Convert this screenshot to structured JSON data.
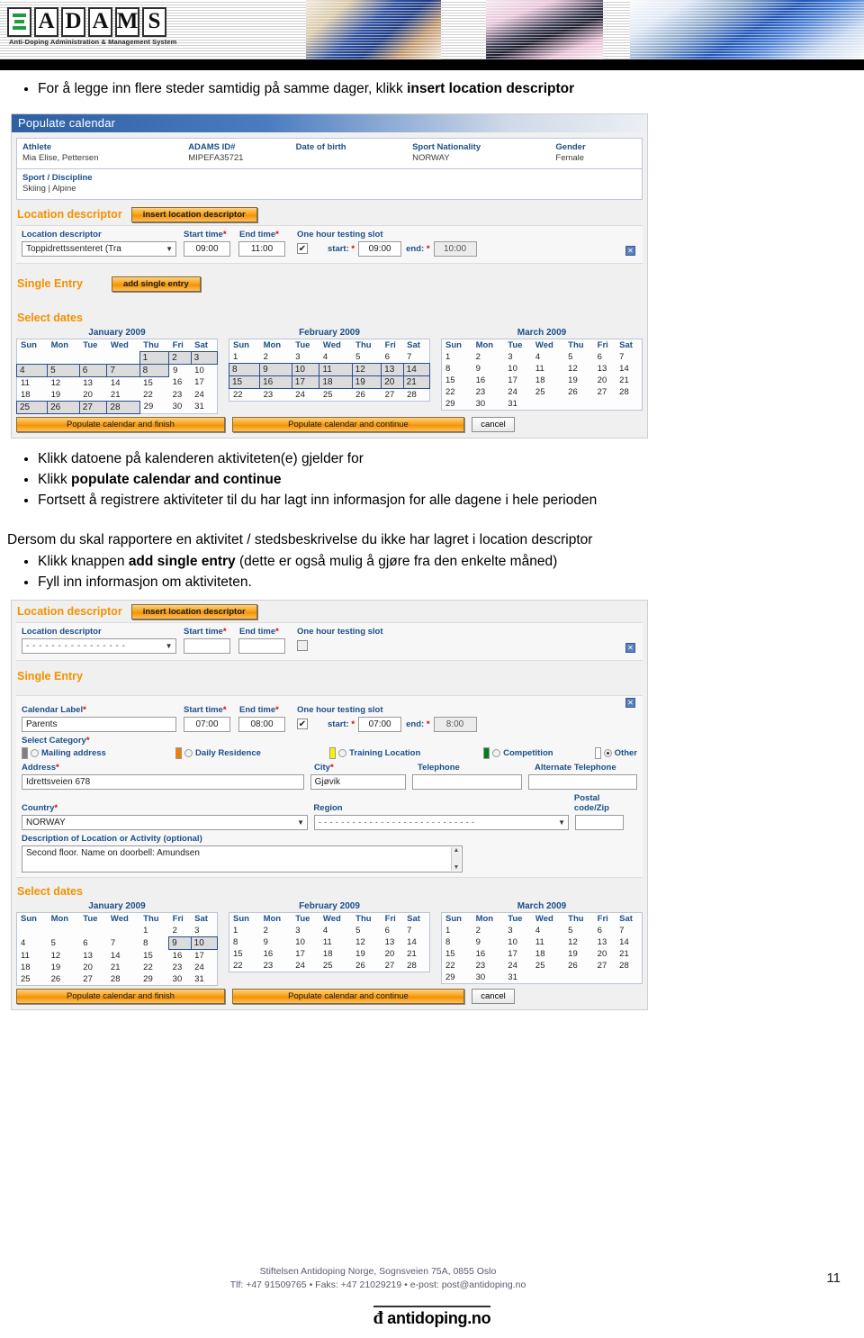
{
  "banner": {
    "logo_letters": [
      "A",
      "D",
      "A",
      "M",
      "S"
    ],
    "subtitle": "Anti-Doping Administration & Management System"
  },
  "intro_bullets": [
    {
      "text": "For å legge inn flere steder samtidig på samme dager, klikk ",
      "bold": "insert location descriptor"
    }
  ],
  "screenshot1": {
    "title": "Populate calendar",
    "athlete": {
      "labels": [
        "Athlete",
        "ADAMS ID#",
        "Date of birth",
        "Sport Nationality",
        "Gender"
      ],
      "values": [
        "Mia Elise, Pettersen",
        "MIPEFA35721",
        "",
        "NORWAY",
        "Female"
      ],
      "sport_label": "Sport / Discipline",
      "sport_value": "Skiing | Alpine"
    },
    "location_section": {
      "title": "Location descriptor",
      "button": "insert location descriptor",
      "headers": [
        "Location descriptor",
        "Start time",
        "End time",
        "One hour testing slot"
      ],
      "descriptor_value": "Toppidrettssenteret (Tra",
      "start_time": "09:00",
      "end_time": "11:00",
      "checkbox_checked": true,
      "slot_start_label": "start:",
      "slot_start": "09:00",
      "slot_end_label": "end:",
      "slot_end": "10:00"
    },
    "single_entry": {
      "title": "Single Entry",
      "button": "add single entry"
    },
    "select_dates": {
      "title": "Select dates",
      "weekdays": [
        "Sun",
        "Mon",
        "Tue",
        "Wed",
        "Thu",
        "Fri",
        "Sat"
      ],
      "months": [
        {
          "name": "January 2009",
          "weeks": [
            [
              "",
              "",
              "",
              "",
              "1",
              "2",
              "3"
            ],
            [
              "4",
              "5",
              "6",
              "7",
              "8",
              "9",
              "10"
            ],
            [
              "11",
              "12",
              "13",
              "14",
              "15",
              "16",
              "17"
            ],
            [
              "18",
              "19",
              "20",
              "21",
              "22",
              "23",
              "24"
            ],
            [
              "25",
              "26",
              "27",
              "28",
              "29",
              "30",
              "31"
            ]
          ],
          "selected": [
            "1",
            "2",
            "3",
            "4",
            "5",
            "6",
            "7",
            "8",
            "25",
            "26",
            "27",
            "28"
          ]
        },
        {
          "name": "February 2009",
          "weeks": [
            [
              "1",
              "2",
              "3",
              "4",
              "5",
              "6",
              "7"
            ],
            [
              "8",
              "9",
              "10",
              "11",
              "12",
              "13",
              "14"
            ],
            [
              "15",
              "16",
              "17",
              "18",
              "19",
              "20",
              "21"
            ],
            [
              "22",
              "23",
              "24",
              "25",
              "26",
              "27",
              "28"
            ]
          ],
          "selected": [
            "8",
            "9",
            "10",
            "11",
            "12",
            "13",
            "14",
            "15",
            "16",
            "17",
            "18",
            "19",
            "20",
            "21"
          ]
        },
        {
          "name": "March 2009",
          "weeks": [
            [
              "1",
              "2",
              "3",
              "4",
              "5",
              "6",
              "7"
            ],
            [
              "8",
              "9",
              "10",
              "11",
              "12",
              "13",
              "14"
            ],
            [
              "15",
              "16",
              "17",
              "18",
              "19",
              "20",
              "21"
            ],
            [
              "22",
              "23",
              "24",
              "25",
              "26",
              "27",
              "28"
            ],
            [
              "29",
              "30",
              "31",
              "",
              "",
              "",
              ""
            ]
          ],
          "selected": []
        }
      ],
      "buttons": [
        "Populate calendar and finish",
        "Populate calendar and continue",
        "cancel"
      ]
    }
  },
  "mid_bullets": [
    {
      "text": "Klikk datoene på kalenderen aktiviteten(e) gjelder for",
      "bold": ""
    },
    {
      "text": "Klikk ",
      "bold": "populate calendar and continue"
    },
    {
      "text": "Fortsett å registrere aktiviteter til du har lagt inn informasjon for alle dagene i hele perioden",
      "bold": ""
    }
  ],
  "mid_paragraph": "Dersom du skal rapportere en aktivitet / stedsbeskrivelse du ikke har lagret i location descriptor",
  "lower_bullets": [
    {
      "pre": "Klikk knappen ",
      "bold": "add single entry",
      "post": " (dette er også mulig å gjøre fra den enkelte måned)"
    },
    {
      "pre": "Fyll inn informasjon om aktiviteten.",
      "bold": "",
      "post": ""
    }
  ],
  "screenshot2": {
    "location_section": {
      "title": "Location descriptor",
      "button": "insert location descriptor",
      "headers": [
        "Location descriptor",
        "Start time",
        "End time",
        "One hour testing slot"
      ],
      "descriptor_value": "- - - - - - - - - - - - - - - -",
      "start_time": "",
      "end_time": "",
      "checkbox_checked": false
    },
    "single_entry": {
      "title": "Single Entry",
      "headers": [
        "Calendar Label",
        "Start time",
        "End time",
        "One hour testing slot"
      ],
      "calendar_label": "Parents",
      "start_time": "07:00",
      "end_time": "08:00",
      "checkbox_checked": true,
      "slot_start_label": "start:",
      "slot_start": "07:00",
      "slot_end_label": "end:",
      "slot_end": "8:00",
      "category_label": "Select Category",
      "categories": [
        {
          "label": "Mailing address",
          "color": "#808080",
          "selected": false
        },
        {
          "label": "Daily Residence",
          "color": "#f57c00",
          "selected": false
        },
        {
          "label": "Training Location",
          "color": "#f5f500",
          "selected": false
        },
        {
          "label": "Competition",
          "color": "#007d1e",
          "selected": false
        },
        {
          "label": "Other",
          "color": "#ffffff",
          "selected": true
        }
      ],
      "address_label": "Address",
      "address_value": "Idrettsveien 678",
      "city_label": "City",
      "city_value": "Gjøvik",
      "telephone_label": "Telephone",
      "telephone_value": "",
      "alt_telephone_label": "Alternate Telephone",
      "alt_telephone_value": "",
      "country_label": "Country",
      "country_value": "NORWAY",
      "region_label": "Region",
      "region_value": "- - - - - - - - - - - - - - - - - - - - - - - - - - - -",
      "postal_label": "Postal code/Zip",
      "postal_value": "",
      "description_label": "Description of Location or Activity (optional)",
      "description_value": "Second floor. Name on doorbell: Amundsen"
    },
    "select_dates": {
      "title": "Select dates",
      "weekdays": [
        "Sun",
        "Mon",
        "Tue",
        "Wed",
        "Thu",
        "Fri",
        "Sat"
      ],
      "months": [
        {
          "name": "January 2009",
          "weeks": [
            [
              "",
              "",
              "",
              "",
              "1",
              "2",
              "3"
            ],
            [
              "4",
              "5",
              "6",
              "7",
              "8",
              "9",
              "10"
            ],
            [
              "11",
              "12",
              "13",
              "14",
              "15",
              "16",
              "17"
            ],
            [
              "18",
              "19",
              "20",
              "21",
              "22",
              "23",
              "24"
            ],
            [
              "25",
              "26",
              "27",
              "28",
              "29",
              "30",
              "31"
            ]
          ],
          "selected": [
            "9",
            "10"
          ]
        },
        {
          "name": "February 2009",
          "weeks": [
            [
              "1",
              "2",
              "3",
              "4",
              "5",
              "6",
              "7"
            ],
            [
              "8",
              "9",
              "10",
              "11",
              "12",
              "13",
              "14"
            ],
            [
              "15",
              "16",
              "17",
              "18",
              "19",
              "20",
              "21"
            ],
            [
              "22",
              "23",
              "24",
              "25",
              "26",
              "27",
              "28"
            ]
          ],
          "selected": []
        },
        {
          "name": "March 2009",
          "weeks": [
            [
              "1",
              "2",
              "3",
              "4",
              "5",
              "6",
              "7"
            ],
            [
              "8",
              "9",
              "10",
              "11",
              "12",
              "13",
              "14"
            ],
            [
              "15",
              "16",
              "17",
              "18",
              "19",
              "20",
              "21"
            ],
            [
              "22",
              "23",
              "24",
              "25",
              "26",
              "27",
              "28"
            ],
            [
              "29",
              "30",
              "31",
              "",
              "",
              "",
              ""
            ]
          ],
          "selected": []
        }
      ],
      "buttons": [
        "Populate calendar and finish",
        "Populate calendar and continue",
        "cancel"
      ]
    }
  },
  "footer": {
    "line1": "Stiftelsen Antidoping Norge, Sognsveien 75A, 0855 Oslo",
    "line2": "Tlf: +47 91509765 • Faks: +47 21029219 • e-post: post@antidoping.no",
    "logo_text": "antidoping.no",
    "page_number": "11"
  }
}
